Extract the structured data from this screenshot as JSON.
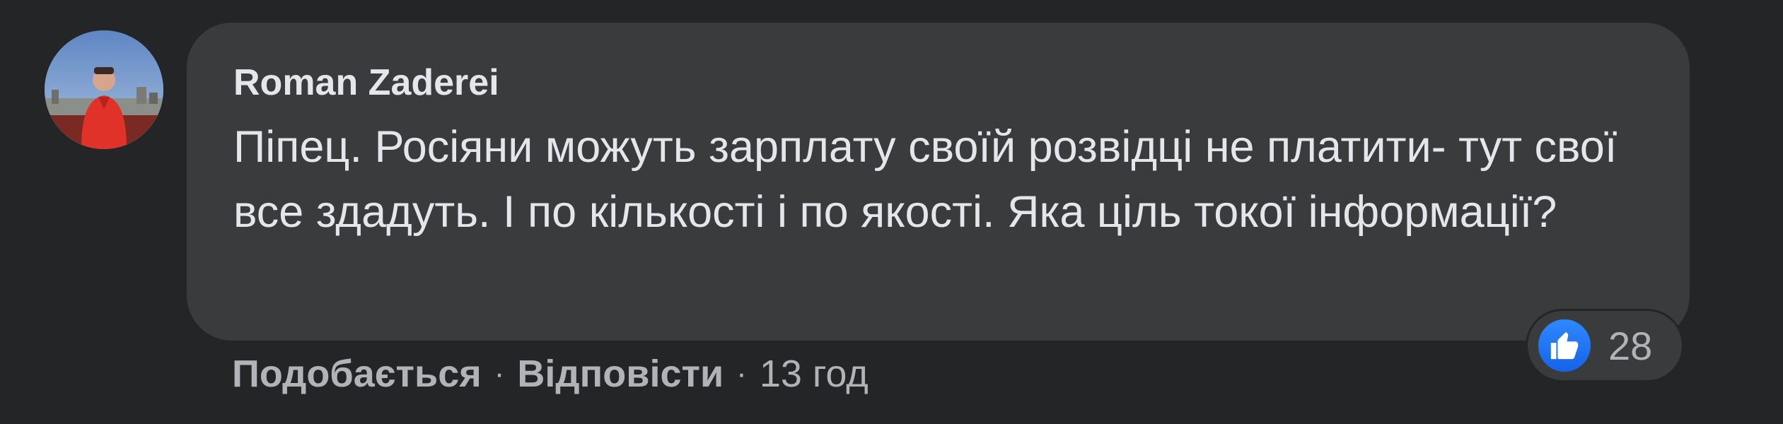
{
  "comment": {
    "author": "Roman Zaderei",
    "text": "Піпец. Росіяни можуть зарплату своїй розвідці не платити- тут свої все здадуть. І по кількості і по якості. Яка ціль токої інформації?",
    "reactions": {
      "icon": "like-icon",
      "count": "28",
      "color": "#1877f2"
    },
    "actions": {
      "like_label": "Подобається",
      "reply_label": "Відповісти",
      "separator": "·",
      "time": "13 год"
    }
  },
  "colors": {
    "background": "#242526",
    "bubble": "#3a3b3c",
    "primary_text": "#e4e6eb",
    "secondary_text": "#b0b3b8"
  }
}
